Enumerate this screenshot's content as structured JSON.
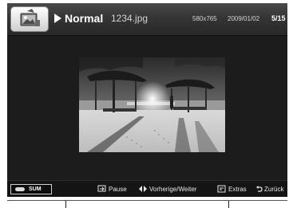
{
  "header": {
    "mode_label": "Normal",
    "file_name": "1234.jpg",
    "resolution": "580x765",
    "date": "2009/01/02",
    "page_counter": "5/15"
  },
  "icons": {
    "app": "photo-viewer-icon",
    "play": "play-icon",
    "sum_remote": "remote-control-icon",
    "pause": "pause-icon",
    "prev_next": "left-right-arrows-icon",
    "extras": "tools-icon",
    "back": "return-icon"
  },
  "main": {
    "photo_alt": "1234.jpg"
  },
  "footer": {
    "sum_label": "SUM",
    "pause_label": "Pause",
    "prev_next_label": "Vorherige/Weiter",
    "extras_label": "Extras",
    "back_label": "Zurück"
  },
  "colors": {
    "screen_background": "#1c1c1c",
    "header_background": "#353535",
    "footer_background": "#151515",
    "text_primary": "#ffffff",
    "text_secondary": "#d4d4d4"
  }
}
